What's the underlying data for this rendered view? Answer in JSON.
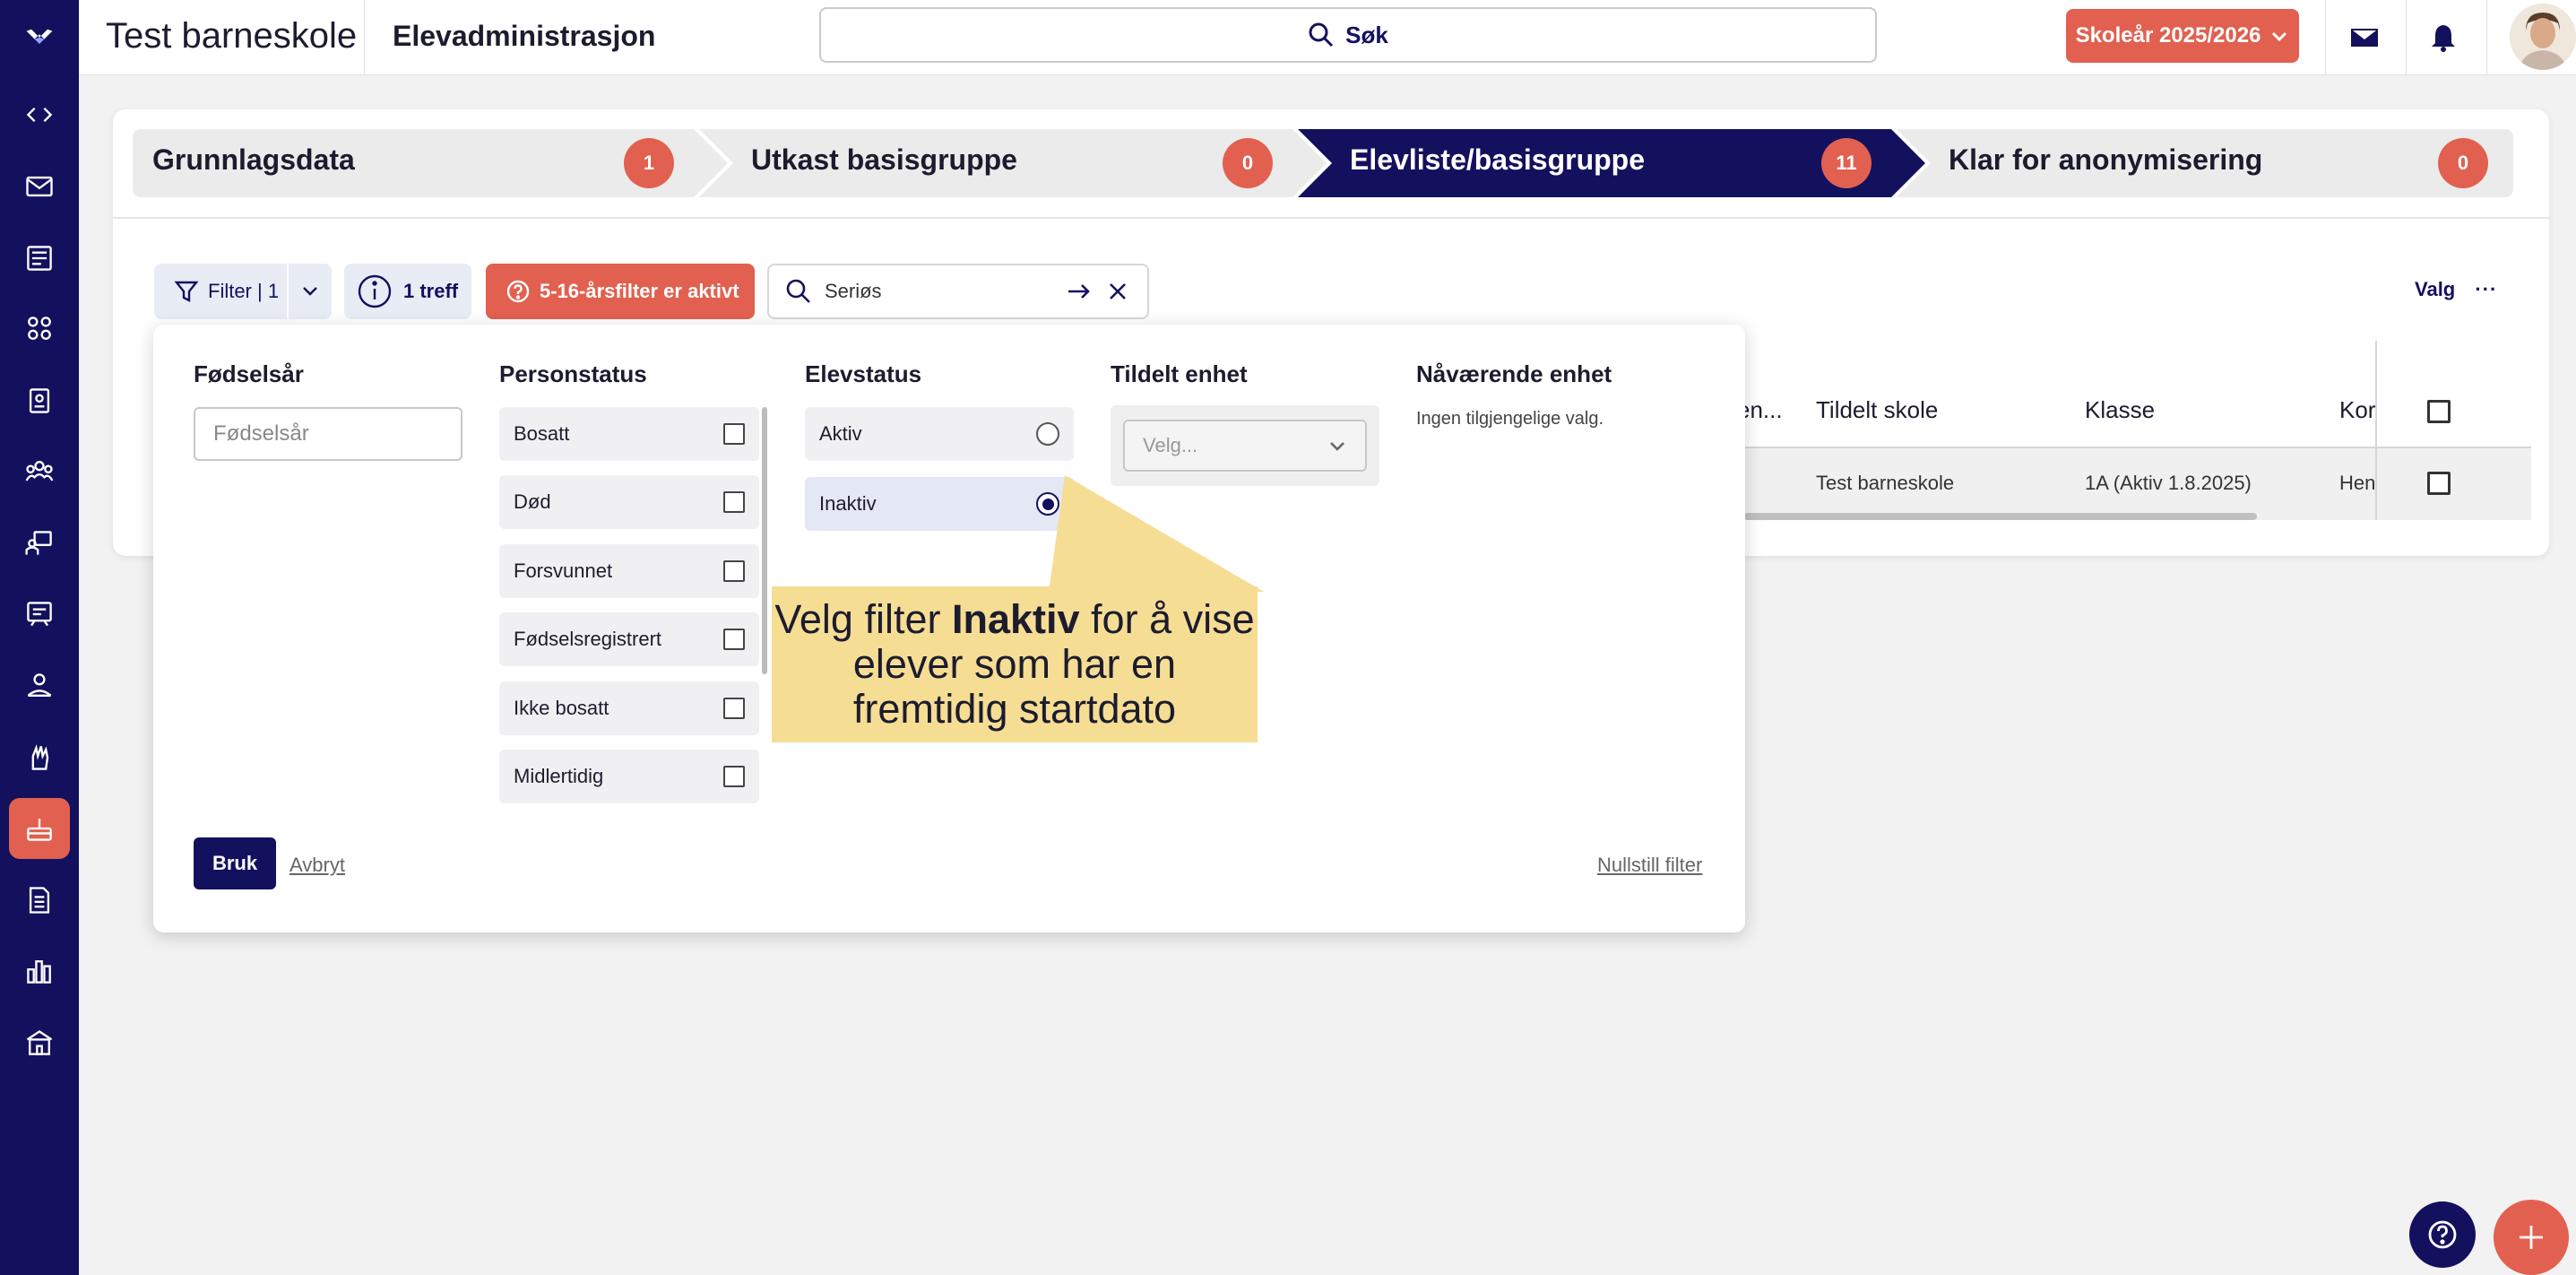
{
  "header": {
    "school": "Test barneskole",
    "app": "Elevadministrasjon",
    "search_label": "Søk",
    "school_year": "Skoleår 2025/2026"
  },
  "sidebar": {
    "icons": [
      "logo-icon",
      "code-icon",
      "mail-icon",
      "news-icon",
      "groups-icon",
      "badge-icon",
      "community-icon",
      "classroom-icon",
      "board-icon",
      "mentor-icon",
      "hand-icon",
      "cake-icon",
      "document-icon",
      "stats-icon",
      "school-icon"
    ],
    "active": "cake-icon"
  },
  "steps": [
    {
      "label": "Grunnlagsdata",
      "count": "1"
    },
    {
      "label": "Utkast basisgruppe",
      "count": "0"
    },
    {
      "label": "Elevliste/basisgruppe",
      "count": "11",
      "current": true
    },
    {
      "label": "Klar for anonymisering",
      "count": "0"
    }
  ],
  "toolbar": {
    "filter_label": "Filter | 1",
    "hits": "1 treff",
    "warning": "5-16-årsfilter er aktivt",
    "search_value": "Seriøs",
    "options_label": "Valg"
  },
  "table": {
    "headers": [
      "en...",
      "Tildelt skole",
      "Klasse",
      "Kor"
    ],
    "row": [
      "Test barneskole",
      "1A (Aktiv 1.8.2025)",
      "Hen"
    ]
  },
  "filter_panel": {
    "birth_year": {
      "title": "Fødselsår",
      "placeholder": "Fødselsår"
    },
    "person_status": {
      "title": "Personstatus",
      "options": [
        "Bosatt",
        "Død",
        "Forsvunnet",
        "Fødselsregistrert",
        "Ikke bosatt",
        "Midlertidig"
      ]
    },
    "student_status": {
      "title": "Elevstatus",
      "options": [
        "Aktiv",
        "Inaktiv"
      ],
      "selected": "Inaktiv"
    },
    "assigned_unit": {
      "title": "Tildelt enhet",
      "placeholder": "Velg..."
    },
    "current_unit": {
      "title": "Nåværende enhet",
      "empty": "Ingen tilgjengelige valg."
    },
    "apply": "Bruk",
    "cancel": "Avbryt",
    "reset": "Nullstill filter"
  },
  "callout": {
    "pre": "Velg filter ",
    "bold": "Inaktiv",
    "post": " for å vise elever som har en fremtidig startdato"
  },
  "colors": {
    "navy": "#13115e",
    "accent": "#e2604f",
    "callout": "#f6dd94"
  }
}
